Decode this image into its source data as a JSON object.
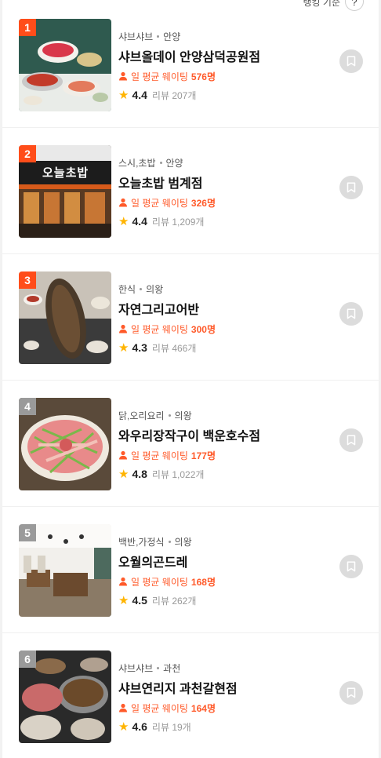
{
  "header": {
    "sort_label": "랭킹 기준",
    "help_label": "?"
  },
  "colors": {
    "accent": "#ff5a2a",
    "rank_hot": "#ff4d1a",
    "rank_cool": "#9a9a9a",
    "star": "#ffb400"
  },
  "items": [
    {
      "rank": "1",
      "category": "샤브샤브",
      "area": "안양",
      "name": "샤브올데이 안양삼덕공원점",
      "waiting_prefix": "일 평균 웨이팅",
      "waiting_count": "576명",
      "score": "4.4",
      "reviews": "리뷰 207개"
    },
    {
      "rank": "2",
      "category": "스시,초밥",
      "area": "안양",
      "name": "오늘초밥 범계점",
      "waiting_prefix": "일 평균 웨이팅",
      "waiting_count": "326명",
      "score": "4.4",
      "reviews": "리뷰 1,209개"
    },
    {
      "rank": "3",
      "category": "한식",
      "area": "의왕",
      "name": "자연그리고어반",
      "waiting_prefix": "일 평균 웨이팅",
      "waiting_count": "300명",
      "score": "4.3",
      "reviews": "리뷰 466개"
    },
    {
      "rank": "4",
      "category": "닭,오리요리",
      "area": "의왕",
      "name": "와우리장작구이 백운호수점",
      "waiting_prefix": "일 평균 웨이팅",
      "waiting_count": "177명",
      "score": "4.8",
      "reviews": "리뷰 1,022개"
    },
    {
      "rank": "5",
      "category": "백반,가정식",
      "area": "의왕",
      "name": "오월의곤드레",
      "waiting_prefix": "일 평균 웨이팅",
      "waiting_count": "168명",
      "score": "4.5",
      "reviews": "리뷰 262개"
    },
    {
      "rank": "6",
      "category": "샤브샤브",
      "area": "과천",
      "name": "샤브연리지 과천갈현점",
      "waiting_prefix": "일 평균 웨이팅",
      "waiting_count": "164명",
      "score": "4.6",
      "reviews": "리뷰 19개"
    }
  ],
  "photo_texts": {
    "sign_2": "오늘초밥"
  }
}
